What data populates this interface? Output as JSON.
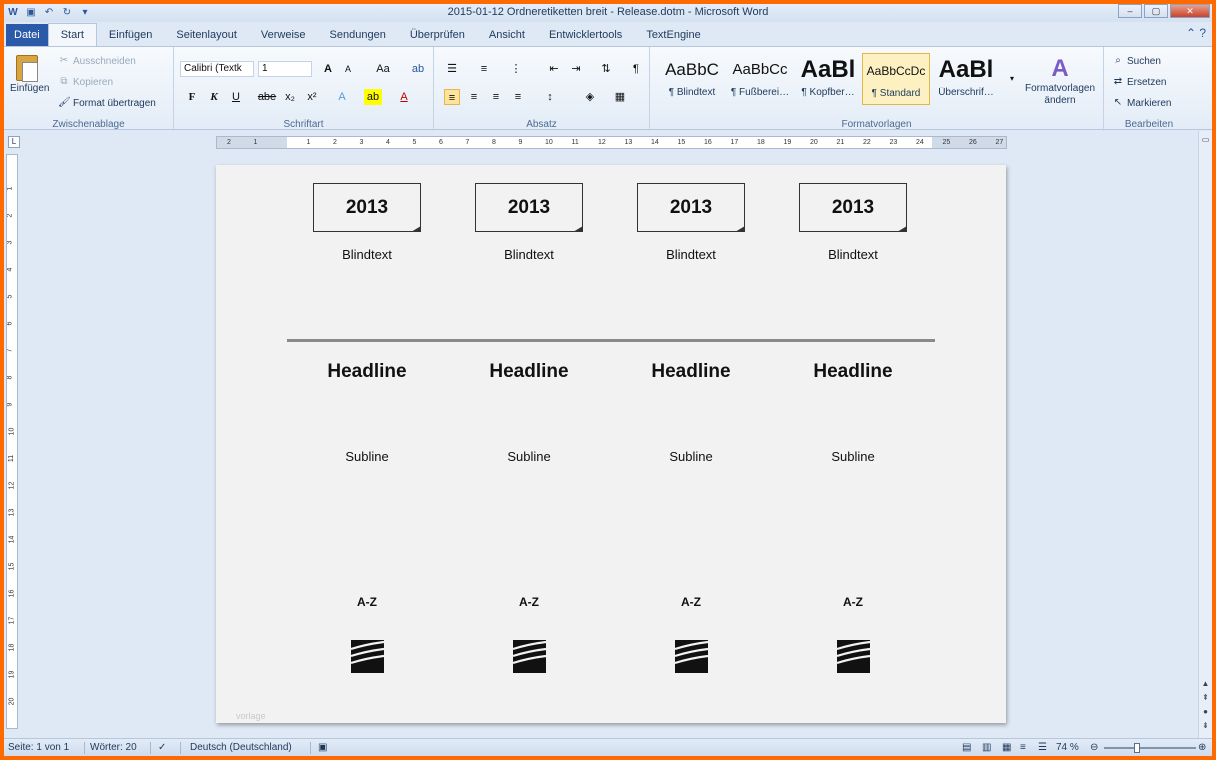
{
  "window": {
    "title": "2015-01-12 Ordneretiketten breit - Release.dotm - Microsoft Word",
    "controls": [
      "–",
      "▢",
      "✕"
    ]
  },
  "qat": {
    "icons": [
      "word-app-icon",
      "save-icon",
      "undo-icon",
      "redo-icon",
      "customize-icon"
    ]
  },
  "tabs": [
    "Datei",
    "Start",
    "Einfügen",
    "Seitenlayout",
    "Verweise",
    "Sendungen",
    "Überprüfen",
    "Ansicht",
    "Entwicklertools",
    "TextEngine"
  ],
  "active_tab": "Start",
  "ribbon": {
    "clipboard": {
      "paste": "Einfügen",
      "cut": "Ausschneiden",
      "copy": "Kopieren",
      "format_painter": "Format übertragen",
      "label": "Zwischenablage"
    },
    "font": {
      "font_name": "Calibri (Textk",
      "font_size": "1",
      "grow": "A",
      "shrink": "A",
      "case": "Aa",
      "clear": "ab",
      "bold": "F",
      "italic": "K",
      "underline": "U",
      "strike": "abe",
      "sub": "x₂",
      "sup": "x²",
      "effects": "A",
      "highlight": "ab",
      "color": "A",
      "label": "Schriftart"
    },
    "paragraph": {
      "pilcrow": "¶",
      "label": "Absatz"
    },
    "styles": {
      "tiles": [
        {
          "sample": "AaBbC",
          "name": "¶ Blindtext"
        },
        {
          "sample": "AaBbCc",
          "name": "¶ Fußberei…"
        },
        {
          "sample": "AaBl",
          "name": "¶ Kopfber…"
        },
        {
          "sample": "AaBbCcDc",
          "name": "¶ Standard"
        },
        {
          "sample": "AaBl",
          "name": "Überschrif…"
        }
      ],
      "change_styles": "Formatvorlagen ändern",
      "label": "Formatvorlagen"
    },
    "editing": {
      "find": "Suchen",
      "replace": "Ersetzen",
      "select": "Markieren",
      "label": "Bearbeiten"
    }
  },
  "ruler_numbers": [
    "2",
    "1",
    "",
    "1",
    "2",
    "3",
    "4",
    "5",
    "6",
    "7",
    "8",
    "9",
    "10",
    "11",
    "12",
    "13",
    "14",
    "15",
    "16",
    "17",
    "18",
    "19",
    "20",
    "21",
    "22",
    "23",
    "24",
    "25",
    "26",
    "27"
  ],
  "vruler_numbers": [
    "1",
    "2",
    "3",
    "4",
    "5",
    "6",
    "7",
    "8",
    "9",
    "10",
    "11",
    "12",
    "13",
    "14",
    "15",
    "16",
    "17",
    "18",
    "19",
    "20"
  ],
  "document": {
    "labels": [
      {
        "year": "2013",
        "blind": "Blindtext",
        "headline": "Headline",
        "subline": "Subline",
        "az": "A-Z"
      },
      {
        "year": "2013",
        "blind": "Blindtext",
        "headline": "Headline",
        "subline": "Subline",
        "az": "A-Z"
      },
      {
        "year": "2013",
        "blind": "Blindtext",
        "headline": "Headline",
        "subline": "Subline",
        "az": "A-Z"
      },
      {
        "year": "2013",
        "blind": "Blindtext",
        "headline": "Headline",
        "subline": "Subline",
        "az": "A-Z"
      }
    ],
    "watermark": "vorlage"
  },
  "status": {
    "page": "Seite: 1 von 1",
    "words": "Wörter: 20",
    "language": "Deutsch (Deutschland)",
    "zoom": "74 %",
    "zoom_value": 74
  }
}
